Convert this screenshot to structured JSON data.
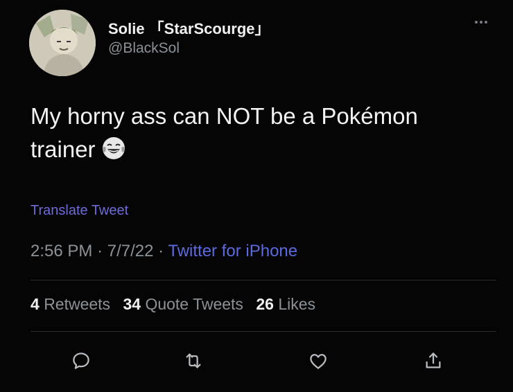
{
  "user": {
    "display_name": "Solie 「StarScourge」",
    "handle": "@BlackSol"
  },
  "tweet": {
    "text_line1": "My horny ass can NOT be a Pokémon",
    "text_line2": "trainer",
    "emoji": "laughing-crying-emoji",
    "translate_label": "Translate Tweet",
    "time": "2:56 PM",
    "date": "7/7/22",
    "source": "Twitter for iPhone",
    "separator": "·"
  },
  "stats": {
    "retweets_count": "4",
    "retweets_label": "Retweets",
    "quote_tweets_count": "34",
    "quote_tweets_label": "Quote Tweets",
    "likes_count": "26",
    "likes_label": "Likes"
  },
  "actions": [
    {
      "icon": "reply-icon"
    },
    {
      "icon": "retweet-icon"
    },
    {
      "icon": "like-icon"
    },
    {
      "icon": "share-icon"
    }
  ],
  "colors": {
    "background": "#050505",
    "text": "#f4f4f4",
    "secondary_text": "#8b9298",
    "link": "#6f6bd8",
    "source_link": "#5b6ae0"
  }
}
